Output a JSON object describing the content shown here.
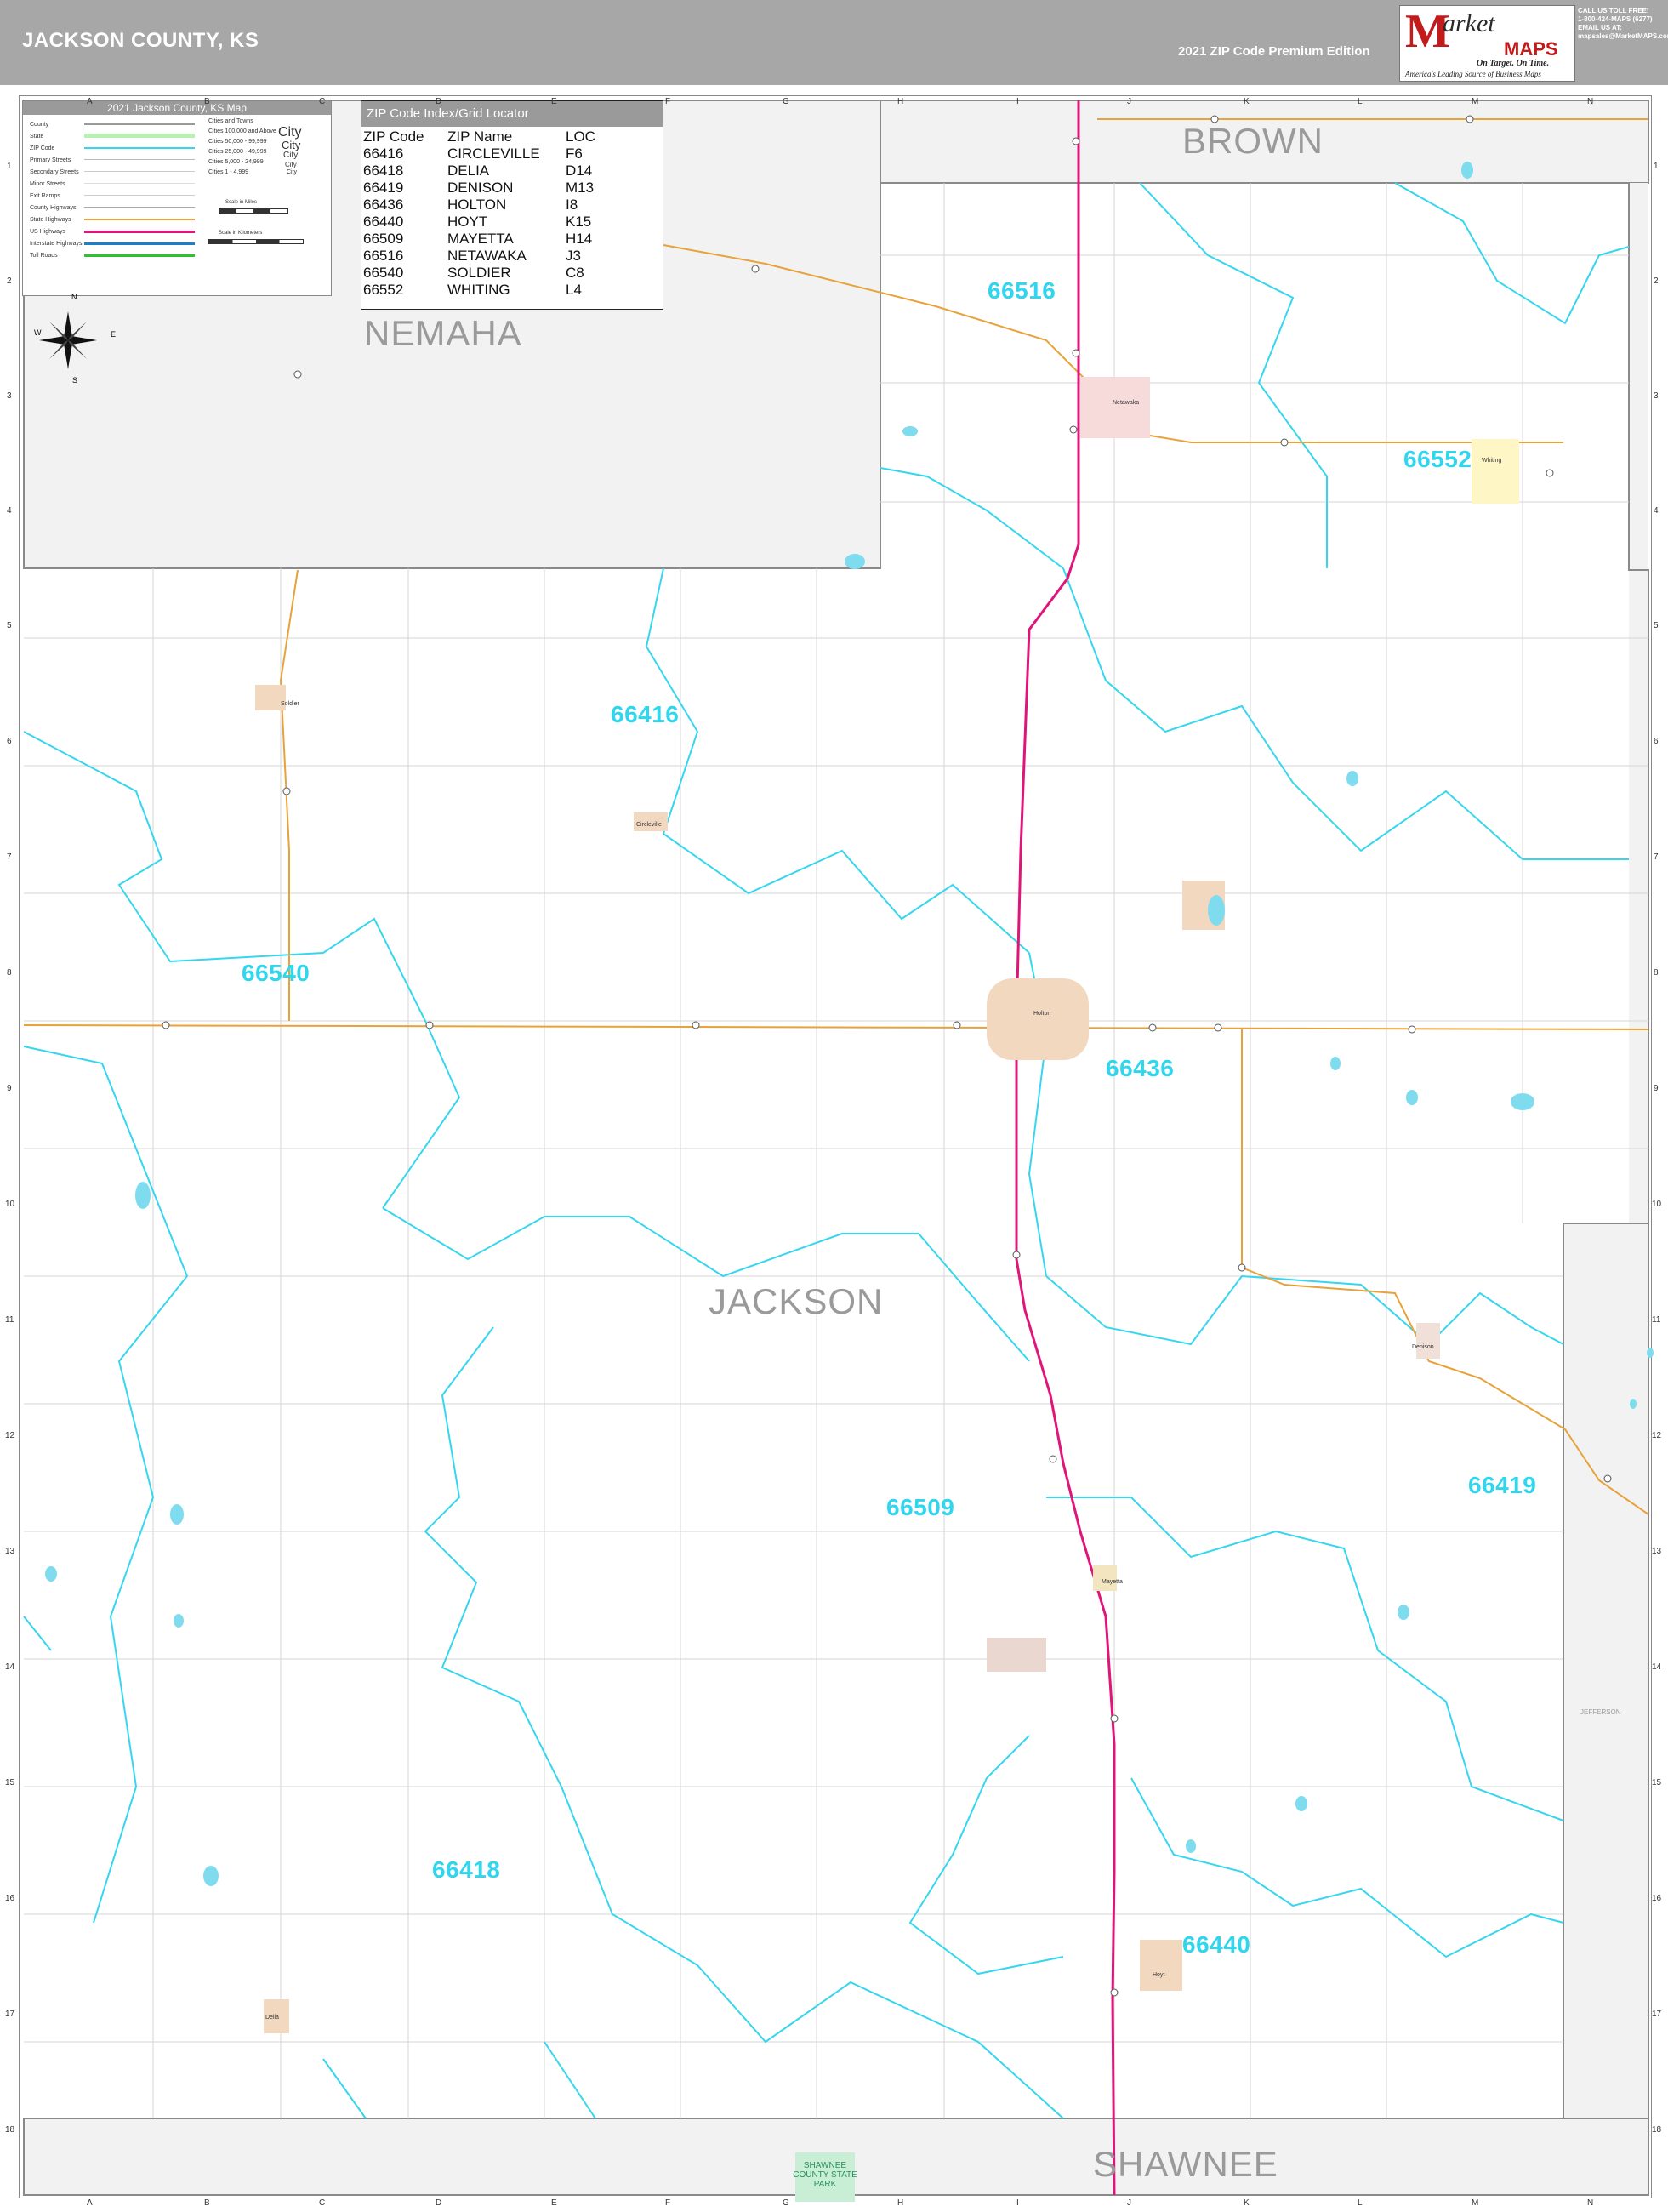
{
  "header": {
    "title": "JACKSON COUNTY, KS",
    "edition": "2021 ZIP Code Premium Edition"
  },
  "logo": {
    "m": "M",
    "market": "arket",
    "maps": "MAPS",
    "tagline1": "On Target. On Time.",
    "tagline2": "America's Leading Source of Business Maps"
  },
  "contact": {
    "line1": "CALL US TOLL FREE!",
    "line2": "1-800-424-MAPS (6277)",
    "line3": "EMAIL US AT:",
    "line4": "mapsales@MarketMAPS.com"
  },
  "legend": {
    "title": "2021 Jackson County, KS Map",
    "items": [
      "County",
      "State",
      "ZIP Code",
      "Primary Streets",
      "Secondary Streets",
      "Minor Streets",
      "Exit Ramps",
      "County Highways",
      "State Highways",
      "US Highways",
      "Interstate Highways",
      "Toll Roads"
    ],
    "cities_header": "Cities and Towns",
    "cities": [
      "Cities 100,000 and Above",
      "Cities 50,000 - 99,999",
      "Cities 25,000 - 49,999",
      "Cities 5,000 - 24,999",
      "Cities 1 - 4,999"
    ],
    "city_samples": [
      "City",
      "City",
      "City",
      "City",
      "City"
    ],
    "scale_miles": "Scale in Miles",
    "scale_km": "Scale in Kilometers",
    "colors": {
      "county": "#9a9a9a",
      "state": "#b7f0b0",
      "zip": "#35d6ee",
      "state_hwy": "#e8a23a",
      "us_hwy": "#e0157a",
      "interstate": "#1e7fc9",
      "toll": "#2ec22e"
    }
  },
  "zip_index": {
    "title": "ZIP Code Index/Grid Locator",
    "headers": [
      "ZIP Code",
      "ZIP Name",
      "LOC"
    ],
    "rows": [
      [
        "66416",
        "CIRCLEVILLE",
        "F6"
      ],
      [
        "66418",
        "DELIA",
        "D14"
      ],
      [
        "66419",
        "DENISON",
        "M13"
      ],
      [
        "66436",
        "HOLTON",
        "I8"
      ],
      [
        "66440",
        "HOYT",
        "K15"
      ],
      [
        "66509",
        "MAYETTA",
        "H14"
      ],
      [
        "66516",
        "NETAWAKA",
        "J3"
      ],
      [
        "66540",
        "SOLDIER",
        "C8"
      ],
      [
        "66552",
        "WHITING",
        "L4"
      ]
    ]
  },
  "compass": {
    "n": "N",
    "s": "S",
    "e": "E",
    "w": "W"
  },
  "counties": {
    "nemaha": "NEMAHA",
    "brown": "BROWN",
    "jackson": "JACKSON",
    "shawnee": "SHAWNEE",
    "jefferson": "JEFFERSON"
  },
  "zip_labels": {
    "z66516": "66516",
    "z66552": "66552",
    "z66416": "66416",
    "z66540": "66540",
    "z66436": "66436",
    "z66509": "66509",
    "z66419": "66419",
    "z66418": "66418",
    "z66440": "66440"
  },
  "towns": {
    "netawaka": "Netawaka",
    "whiting": "Whiting",
    "soldier": "Soldier",
    "circleville": "Circleville",
    "holton": "Holton",
    "denison": "Denison",
    "mayetta": "Mayetta",
    "hoyt": "Hoyt",
    "delia": "Delia"
  },
  "park": "SHAWNEE COUNTY STATE PARK",
  "grid": {
    "letters": [
      "A",
      "B",
      "C",
      "D",
      "E",
      "F",
      "G",
      "H",
      "I",
      "J",
      "K",
      "L",
      "M",
      "N"
    ],
    "numbers": [
      "1",
      "2",
      "3",
      "4",
      "5",
      "6",
      "7",
      "8",
      "9",
      "10",
      "11",
      "12",
      "13",
      "14",
      "15",
      "16",
      "17",
      "18"
    ]
  }
}
